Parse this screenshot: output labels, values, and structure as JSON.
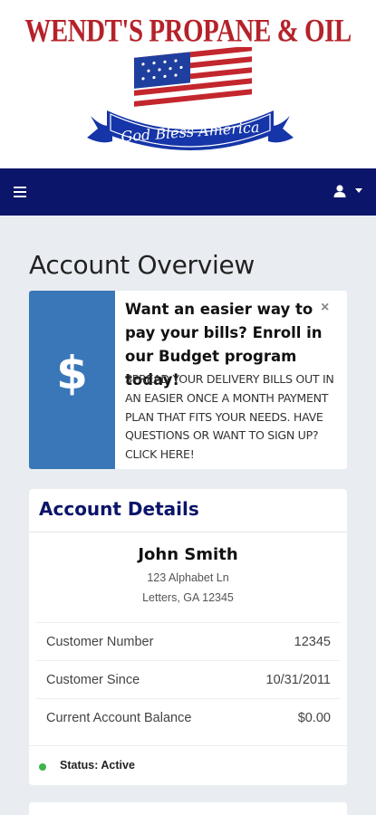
{
  "brand": {
    "logo_title": "WENDT'S PROPANE & OIL",
    "logo_banner": "God Bless America",
    "colors": {
      "red": "#b5222a",
      "navy": "#0b1569",
      "blue": "#3a77b8"
    }
  },
  "navbar": {
    "menu_icon": "hamburger-icon",
    "user_icon": "user-icon"
  },
  "page": {
    "title": "Account Overview"
  },
  "promo": {
    "icon": "dollar-icon",
    "icon_glyph": "$",
    "close_glyph": "×",
    "heading": "Want an easier way to pay your bills? Enroll in our Budget program today!",
    "text": "SPREAD YOUR DELIVERY BILLS OUT IN AN EASIER ONCE A MONTH PAYMENT PLAN THAT FITS YOUR NEEDS. HAVE QUESTIONS OR WANT TO SIGN UP? CLICK HERE!"
  },
  "account": {
    "title": "Account Details",
    "name": "John Smith",
    "address_line1": "123 Alphabet Ln",
    "address_line2": "Letters, GA 12345",
    "rows": [
      {
        "label": "Customer Number",
        "value": "12345"
      },
      {
        "label": "Customer Since",
        "value": "10/31/2011"
      },
      {
        "label": "Current Account Balance",
        "value": "$0.00"
      }
    ],
    "status": "Status: Active",
    "status_color": "#3cb44b"
  }
}
